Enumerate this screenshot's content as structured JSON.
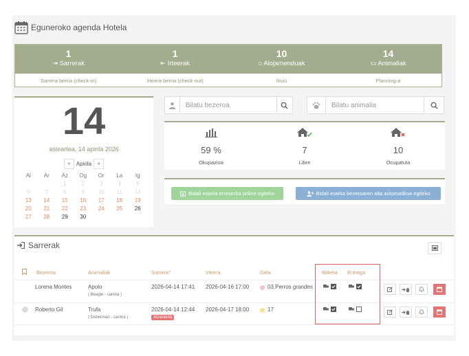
{
  "header": {
    "title": "Eguneroko agenda Hotela"
  },
  "stats": [
    {
      "num": "1",
      "label": "Sarrerak",
      "icon": "sign-in-icon",
      "link": "Sarrera berria (check-in)"
    },
    {
      "num": "1",
      "label": "Irteerak",
      "icon": "sign-out-icon",
      "link": "Irteera berria (check-out)"
    },
    {
      "num": "10",
      "label": "Alojamenduak",
      "icon": "home-icon",
      "link": "Ikusi"
    },
    {
      "num": "14",
      "label": "Animaliak",
      "icon": "bed-icon",
      "link": "Planning-a"
    }
  ],
  "calendar": {
    "day": "14",
    "date_line": "asteartea, 14 apirila 2026",
    "month": "Apirila",
    "prev": "«",
    "next": "»",
    "weekdays": [
      "Al",
      "Ar",
      "Az",
      "Og",
      "Or",
      "La",
      "Ig"
    ],
    "weeks": [
      [
        "",
        "",
        "1",
        "2",
        "3",
        "4",
        "5"
      ],
      [
        "6",
        "7",
        "8",
        "9",
        "10",
        "11",
        "12"
      ],
      [
        "13",
        "14",
        "15",
        "16",
        "17",
        "18",
        "19"
      ],
      [
        "20",
        "21",
        "22",
        "23",
        "24",
        "25",
        "26"
      ],
      [
        "27",
        "28",
        "29",
        "30",
        "",
        "",
        ""
      ]
    ]
  },
  "search": {
    "client_placeholder": "Bilatu bezeroa",
    "animal_placeholder": "Bilatu animalia"
  },
  "occupancy": [
    {
      "value": "59 %",
      "label": "Okupazioa",
      "icon": "bar-chart-icon"
    },
    {
      "value": "7",
      "label": "Libre",
      "icon": "home-check-icon"
    },
    {
      "value": "10",
      "label": "Ocupatuta",
      "icon": "home-x-icon"
    }
  ],
  "actions": {
    "online_booking": "Bidali esteka erreserba online egiteko",
    "auto_register": "Bidali esteka bezeroaren alta automatikoa egiteko"
  },
  "arrivals": {
    "title": "Sarrerak",
    "columns": [
      "Bezeroa",
      "Animaliak",
      "Sarrera",
      "Irteera",
      "Gela",
      "Bilketa",
      "Entrega"
    ],
    "sort_marker": "^",
    "rows": [
      {
        "client": "Lorena Montes",
        "animal": "Apolo",
        "animal_sub": "( Beagle - canina )",
        "arrival": "2026-04-14 17:41",
        "departure": "2026-04-16 17:00",
        "room": "03.Perros grandes",
        "room_color": "#f4c2cc",
        "badge": "",
        "pickup_checked": true,
        "delivery_checked": true
      },
      {
        "client": "Roberto Gil",
        "animal": "Trufa",
        "animal_sub": "( Doberman - canina )",
        "arrival": "2026-04-14 12:44",
        "departure": "2026-04-17 18:00",
        "room": "17",
        "room_color": "#f6e58d",
        "badge": "Atzeratuta",
        "pickup_checked": true,
        "delivery_checked": false
      }
    ]
  }
}
